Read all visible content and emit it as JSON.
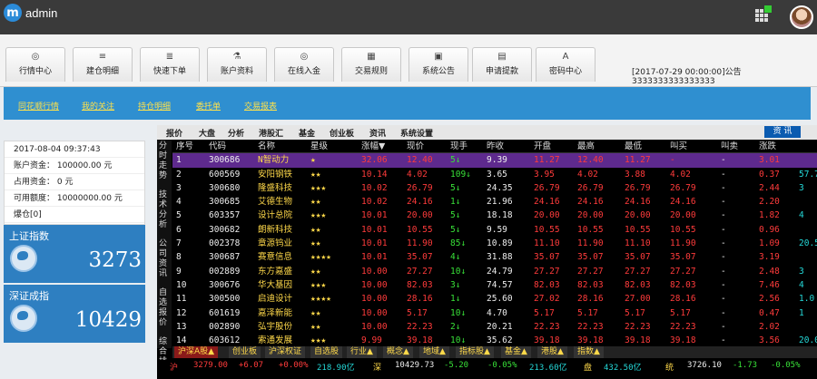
{
  "app": {
    "name": "admin"
  },
  "header": {
    "notice": "[2017-07-29 00:00:00]公告3333333333333333"
  },
  "nav": [
    {
      "label": "行情中心",
      "icon": "dashboard-icon"
    },
    {
      "label": "建仓明细",
      "icon": "list-icon"
    },
    {
      "label": "快速下单",
      "icon": "list-icon"
    },
    {
      "label": "账户资料",
      "icon": "flask-icon"
    },
    {
      "label": "在线入金",
      "icon": "dashboard-icon"
    },
    {
      "label": "交易规则",
      "icon": "grid-icon"
    },
    {
      "label": "系统公告",
      "icon": "image-icon"
    },
    {
      "label": "申请提款",
      "icon": "calendar-icon"
    },
    {
      "label": "密码中心",
      "icon": "font-icon"
    }
  ],
  "subnav": [
    "同花顺行情",
    "我的关注",
    "持仓明细",
    "委托单",
    "交易报表"
  ],
  "account": {
    "datetime": "2017-08-04 09:37:43",
    "balance": "账户资金： 100000.00 元",
    "occupied": "占用资金： 0 元",
    "credit": "可用额度： 10000000.00 元",
    "positions": "爆仓[0]"
  },
  "indices": [
    {
      "name": "上证指数",
      "value": "3273"
    },
    {
      "name": "深证成指",
      "value": "10429"
    }
  ],
  "market": {
    "tabs": [
      "报价",
      "大盘",
      "分析",
      "港股汇",
      "基金",
      "创业板",
      "资讯",
      "系统设置"
    ],
    "data_button": "资 讯",
    "side_tabs": [
      "分时走势",
      "技术分析",
      "公司资讯",
      "自选报价",
      "综合排"
    ],
    "headers": [
      "序号",
      "代码",
      "名称",
      "星级",
      "涨幅▼",
      "现价",
      "现手",
      "昨收",
      "开盘",
      "最高",
      "最低",
      "叫买",
      "叫卖",
      "涨跌",
      ""
    ],
    "rows": [
      [
        "1",
        "300686",
        "N智动力",
        "★",
        "32.06",
        "12.40",
        "5↓",
        "9.39",
        "11.27",
        "12.40",
        "11.27",
        "-",
        "-",
        "3.01",
        ""
      ],
      [
        "2",
        "600569",
        "安阳钢铁",
        "★★",
        "10.14",
        "4.02",
        "109↓",
        "3.65",
        "3.95",
        "4.02",
        "3.88",
        "4.02",
        "-",
        "0.37",
        "57.7"
      ],
      [
        "3",
        "300680",
        "隆盛科技",
        "★★★",
        "10.02",
        "26.79",
        "5↓",
        "24.35",
        "26.79",
        "26.79",
        "26.79",
        "26.79",
        "-",
        "2.44",
        "3"
      ],
      [
        "4",
        "300685",
        "艾德生物",
        "★★",
        "10.02",
        "24.16",
        "1↓",
        "21.96",
        "24.16",
        "24.16",
        "24.16",
        "24.16",
        "-",
        "2.20",
        ""
      ],
      [
        "5",
        "603357",
        "设计总院",
        "★★★",
        "10.01",
        "20.00",
        "5↓",
        "18.18",
        "20.00",
        "20.00",
        "20.00",
        "20.00",
        "-",
        "1.82",
        "4"
      ],
      [
        "6",
        "300682",
        "朗新科技",
        "★★",
        "10.01",
        "10.55",
        "5↓",
        "9.59",
        "10.55",
        "10.55",
        "10.55",
        "10.55",
        "-",
        "0.96",
        ""
      ],
      [
        "7",
        "002378",
        "章源钨业",
        "★★",
        "10.01",
        "11.90",
        "85↓",
        "10.89",
        "11.10",
        "11.90",
        "11.10",
        "11.90",
        "-",
        "1.09",
        "20.5"
      ],
      [
        "8",
        "300687",
        "赛意信息",
        "★★★★",
        "10.01",
        "35.07",
        "4↓",
        "31.88",
        "35.07",
        "35.07",
        "35.07",
        "35.07",
        "-",
        "3.19",
        ""
      ],
      [
        "9",
        "002889",
        "东方嘉盛",
        "★★",
        "10.00",
        "27.27",
        "10↓",
        "24.79",
        "27.27",
        "27.27",
        "27.27",
        "27.27",
        "-",
        "2.48",
        "3"
      ],
      [
        "10",
        "300676",
        "华大基因",
        "★★★",
        "10.00",
        "82.03",
        "3↓",
        "74.57",
        "82.03",
        "82.03",
        "82.03",
        "82.03",
        "-",
        "7.46",
        "4"
      ],
      [
        "11",
        "300500",
        "启迪设计",
        "★★★★",
        "10.00",
        "28.16",
        "1↓",
        "25.60",
        "27.02",
        "28.16",
        "27.00",
        "28.16",
        "-",
        "2.56",
        "1.0"
      ],
      [
        "12",
        "601619",
        "嘉泽新能",
        "★★",
        "10.00",
        "5.17",
        "10↓",
        "4.70",
        "5.17",
        "5.17",
        "5.17",
        "5.17",
        "-",
        "0.47",
        "1"
      ],
      [
        "13",
        "002890",
        "弘宇股份",
        "★★",
        "10.00",
        "22.23",
        "2↓",
        "20.21",
        "22.23",
        "22.23",
        "22.23",
        "22.23",
        "-",
        "2.02",
        ""
      ],
      [
        "14",
        "603612",
        "索通发展",
        "★★★",
        "9.99",
        "39.18",
        "10↓",
        "35.62",
        "39.18",
        "39.18",
        "39.18",
        "39.18",
        "-",
        "3.56",
        "20.0"
      ]
    ],
    "bottom_tabs": [
      "沪深A股▲",
      "创业板",
      "沪深权证",
      "自选股",
      "行业▲",
      "概念▲",
      "地域▲",
      "指标股▲",
      "基金▲",
      "港股▲",
      "指数▲"
    ],
    "status": [
      {
        "text": "沪",
        "color": "#ff3b3b"
      },
      {
        "text": "3279.00",
        "color": "#ff3b3b"
      },
      {
        "text": "+6.07",
        "color": "#ff3b3b"
      },
      {
        "text": "+0.00%",
        "color": "#ff3b3b"
      },
      {
        "text": "218.90亿",
        "color": "#24d8d8"
      },
      {
        "text": "深",
        "color": "#ffd94a"
      },
      {
        "text": "10429.73",
        "color": "#eee"
      },
      {
        "text": "-5.20",
        "color": "#38e038"
      },
      {
        "text": "-0.05%",
        "color": "#38e038"
      },
      {
        "text": "213.60亿",
        "color": "#24d8d8"
      },
      {
        "text": "盘",
        "color": "#ffd94a"
      },
      {
        "text": "432.50亿",
        "color": "#24d8d8"
      },
      {
        "text": "统",
        "color": "#ffd94a"
      },
      {
        "text": "3726.10",
        "color": "#eee"
      },
      {
        "text": "-1.73",
        "color": "#38e038"
      },
      {
        "text": "-0.05%",
        "color": "#38e038"
      }
    ]
  }
}
